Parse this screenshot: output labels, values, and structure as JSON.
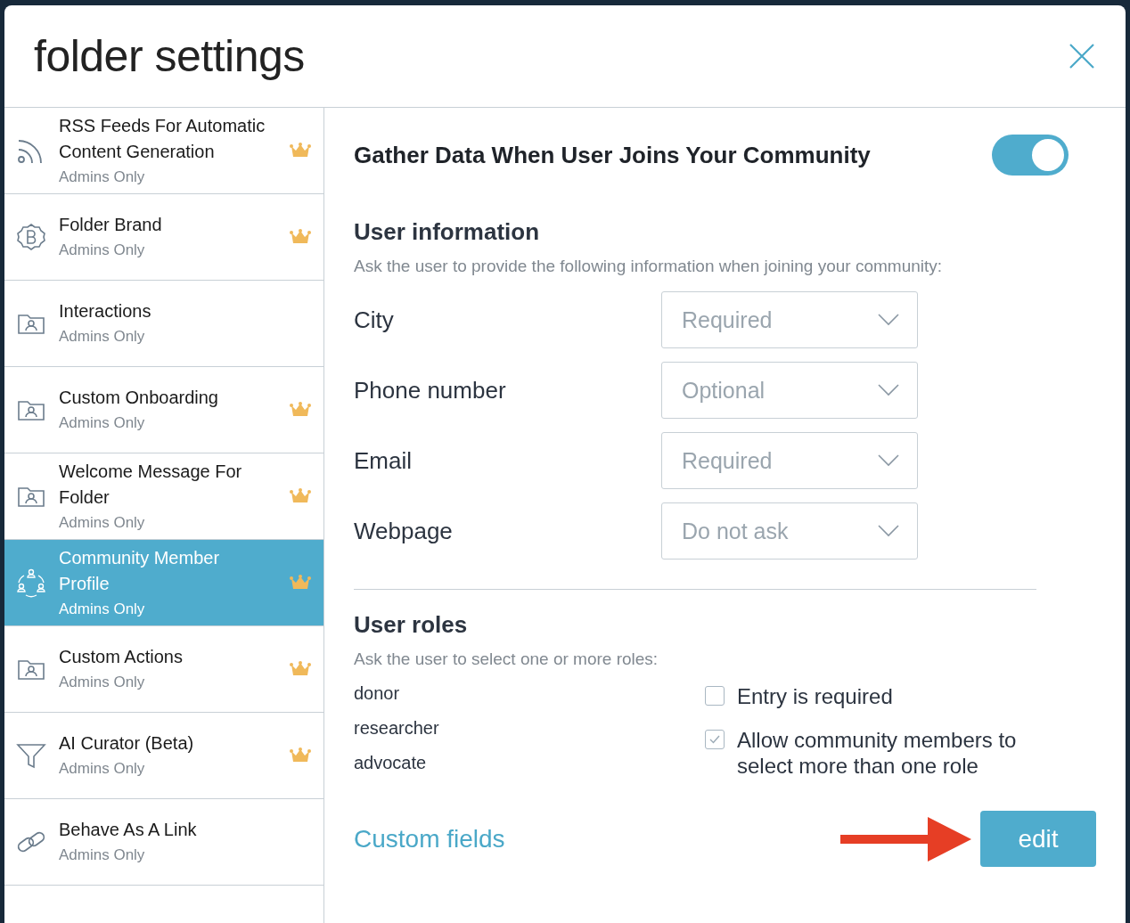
{
  "dialog": {
    "title": "folder settings"
  },
  "sidebar": {
    "items": [
      {
        "kind": "rss",
        "title": "RSS Feeds For Automatic Content Generation",
        "subtitle": "Admins Only",
        "premium": true,
        "selected": false
      },
      {
        "kind": "badge",
        "title": "Folder Brand",
        "subtitle": "Admins Only",
        "premium": true,
        "selected": false
      },
      {
        "kind": "folder",
        "title": "Interactions",
        "subtitle": "Admins Only",
        "premium": false,
        "selected": false
      },
      {
        "kind": "folder",
        "title": "Custom Onboarding",
        "subtitle": "Admins Only",
        "premium": true,
        "selected": false
      },
      {
        "kind": "folder",
        "title": "Welcome Message For Folder",
        "subtitle": "Admins Only",
        "premium": true,
        "selected": false
      },
      {
        "kind": "people",
        "title": "Community Member Profile",
        "subtitle": "Admins Only",
        "premium": true,
        "selected": true
      },
      {
        "kind": "folder",
        "title": "Custom Actions",
        "subtitle": "Admins Only",
        "premium": true,
        "selected": false
      },
      {
        "kind": "filter",
        "title": "AI Curator (Beta)",
        "subtitle": "Admins Only",
        "premium": true,
        "selected": false
      },
      {
        "kind": "link",
        "title": "Behave As A Link",
        "subtitle": "Admins Only",
        "premium": false,
        "selected": false
      }
    ]
  },
  "main": {
    "heading": "Gather Data When User Joins Your Community",
    "toggle": {
      "on": true
    },
    "user_information": {
      "title": "User information",
      "description": "Ask the user to provide the following information when joining your community:",
      "fields": [
        {
          "label": "City",
          "value": "Required"
        },
        {
          "label": "Phone number",
          "value": "Optional"
        },
        {
          "label": "Email",
          "value": "Required"
        },
        {
          "label": "Webpage",
          "value": "Do not ask"
        }
      ]
    },
    "user_roles": {
      "title": "User roles",
      "description": "Ask the user to select one or more roles:",
      "roles": [
        "donor",
        "researcher",
        "advocate"
      ],
      "options": [
        {
          "label": "Entry is required",
          "checked": false
        },
        {
          "label": "Allow community members to select more than one role",
          "checked": true
        }
      ]
    },
    "custom_fields_link": "Custom fields",
    "edit_button": "edit"
  }
}
